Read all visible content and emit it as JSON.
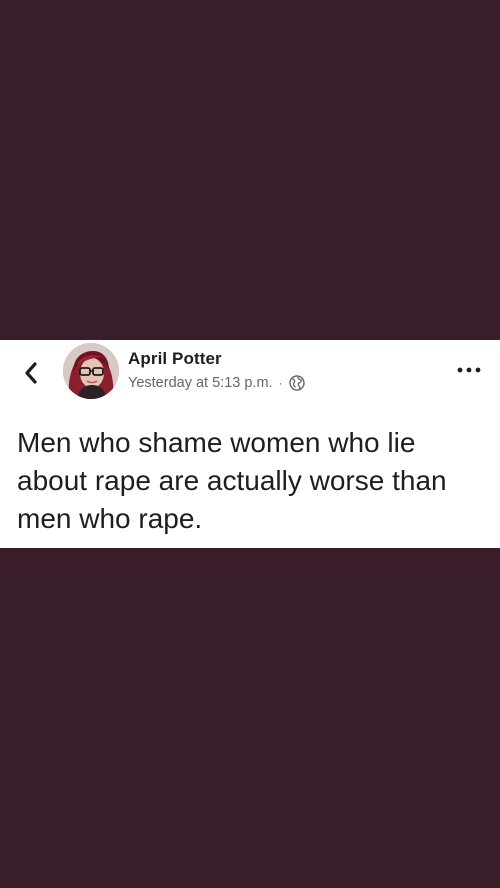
{
  "post": {
    "author": "April Potter",
    "timestamp": "Yesterday at 5:13 p.m.",
    "separator": "·",
    "audience_icon": "globe-icon",
    "text": "Men who shame women who lie about rape are actually worse than men who rape."
  },
  "icons": {
    "back": "chevron-left-icon",
    "more": "more-horizontal-icon"
  },
  "colors": {
    "background": "#3b1e2c",
    "card": "#ffffff",
    "text_primary": "#1c1e21",
    "text_secondary": "#606770"
  }
}
